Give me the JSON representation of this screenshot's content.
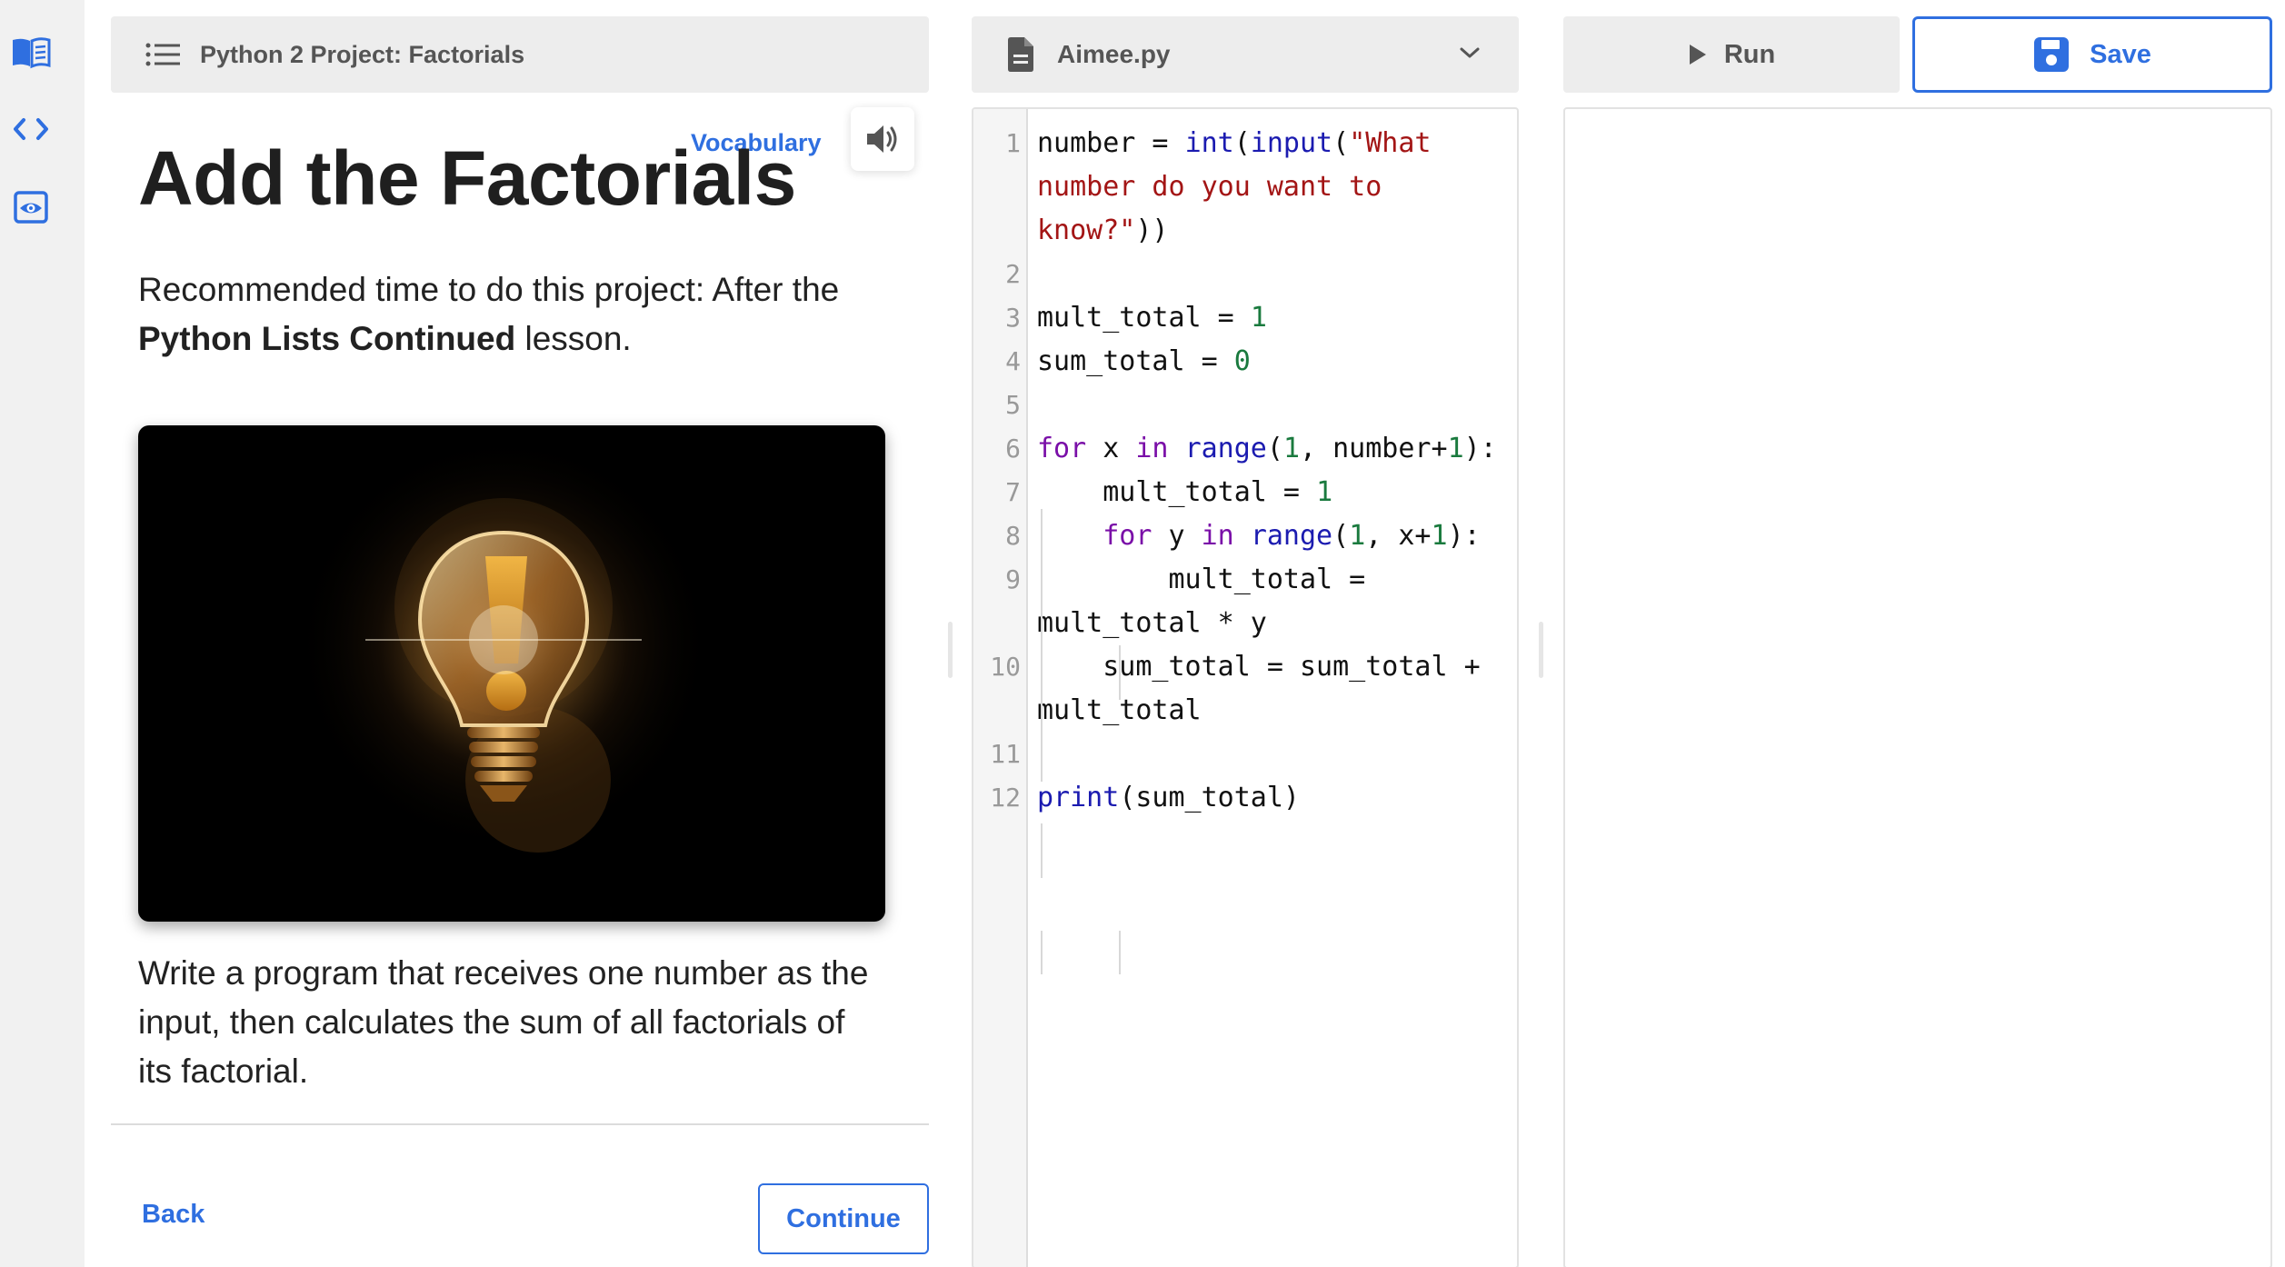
{
  "rail": {
    "items": [
      {
        "name": "lesson-book-icon"
      },
      {
        "name": "code-icon"
      },
      {
        "name": "preview-eye-icon"
      }
    ]
  },
  "lesson": {
    "breadcrumb": "Python 2 Project: Factorials",
    "vocabulary": "Vocabulary",
    "title": "Add the Factorials",
    "intro_prefix": "Recommended time to do this project: After the ",
    "intro_bold": "Python Lists Continued",
    "intro_suffix": " lesson.",
    "image_icon": "lightbulb-exclamation-image",
    "task": "Write a program that receives one number as the input, then calculates the sum of all factorials of its factorial.",
    "back_label": "Back",
    "continue_label": "Continue"
  },
  "editor": {
    "filename": "Aimee.py",
    "lines": [
      {
        "num": "1",
        "tokens": [
          [
            "number = ",
            ""
          ],
          [
            "int",
            "bi"
          ],
          [
            "(",
            ""
          ],
          [
            "input",
            "bi"
          ],
          [
            "(",
            ""
          ],
          [
            "\"What number do you want to know?\"",
            "str"
          ],
          [
            "))",
            ""
          ]
        ]
      },
      {
        "num": "2",
        "tokens": []
      },
      {
        "num": "3",
        "tokens": [
          [
            "mult_total = ",
            ""
          ],
          [
            "1",
            "num"
          ]
        ]
      },
      {
        "num": "4",
        "tokens": [
          [
            "sum_total = ",
            ""
          ],
          [
            "0",
            "num"
          ]
        ]
      },
      {
        "num": "5",
        "tokens": []
      },
      {
        "num": "6",
        "tokens": [
          [
            "for",
            "kw"
          ],
          [
            " x ",
            ""
          ],
          [
            "in",
            "kw"
          ],
          [
            " ",
            ""
          ],
          [
            "range",
            "bi"
          ],
          [
            "(",
            ""
          ],
          [
            "1",
            "num"
          ],
          [
            ", number+",
            ""
          ],
          [
            "1",
            "num"
          ],
          [
            "):",
            ""
          ]
        ]
      },
      {
        "num": "7",
        "tokens": [
          [
            "    mult_total = ",
            ""
          ],
          [
            "1",
            "num"
          ]
        ]
      },
      {
        "num": "8",
        "tokens": [
          [
            "    ",
            ""
          ],
          [
            "for",
            "kw"
          ],
          [
            " y ",
            ""
          ],
          [
            "in",
            "kw"
          ],
          [
            " ",
            ""
          ],
          [
            "range",
            "bi"
          ],
          [
            "(",
            ""
          ],
          [
            "1",
            "num"
          ],
          [
            ", x+",
            ""
          ],
          [
            "1",
            "num"
          ],
          [
            "):",
            ""
          ]
        ]
      },
      {
        "num": "9",
        "tokens": [
          [
            "        mult_total = mult_total * y",
            ""
          ]
        ]
      },
      {
        "num": "10",
        "tokens": [
          [
            "    sum_total = sum_total + mult_total",
            ""
          ]
        ]
      },
      {
        "num": "11",
        "tokens": []
      },
      {
        "num": "12",
        "tokens": [
          [
            "print",
            "bi"
          ],
          [
            "(sum_total)",
            ""
          ]
        ]
      }
    ]
  },
  "toolbar": {
    "run_label": "Run",
    "save_label": "Save"
  },
  "colors": {
    "accent": "#2f6fe0",
    "header_bg": "#ededed",
    "rail_bg": "#f1f1f1"
  }
}
